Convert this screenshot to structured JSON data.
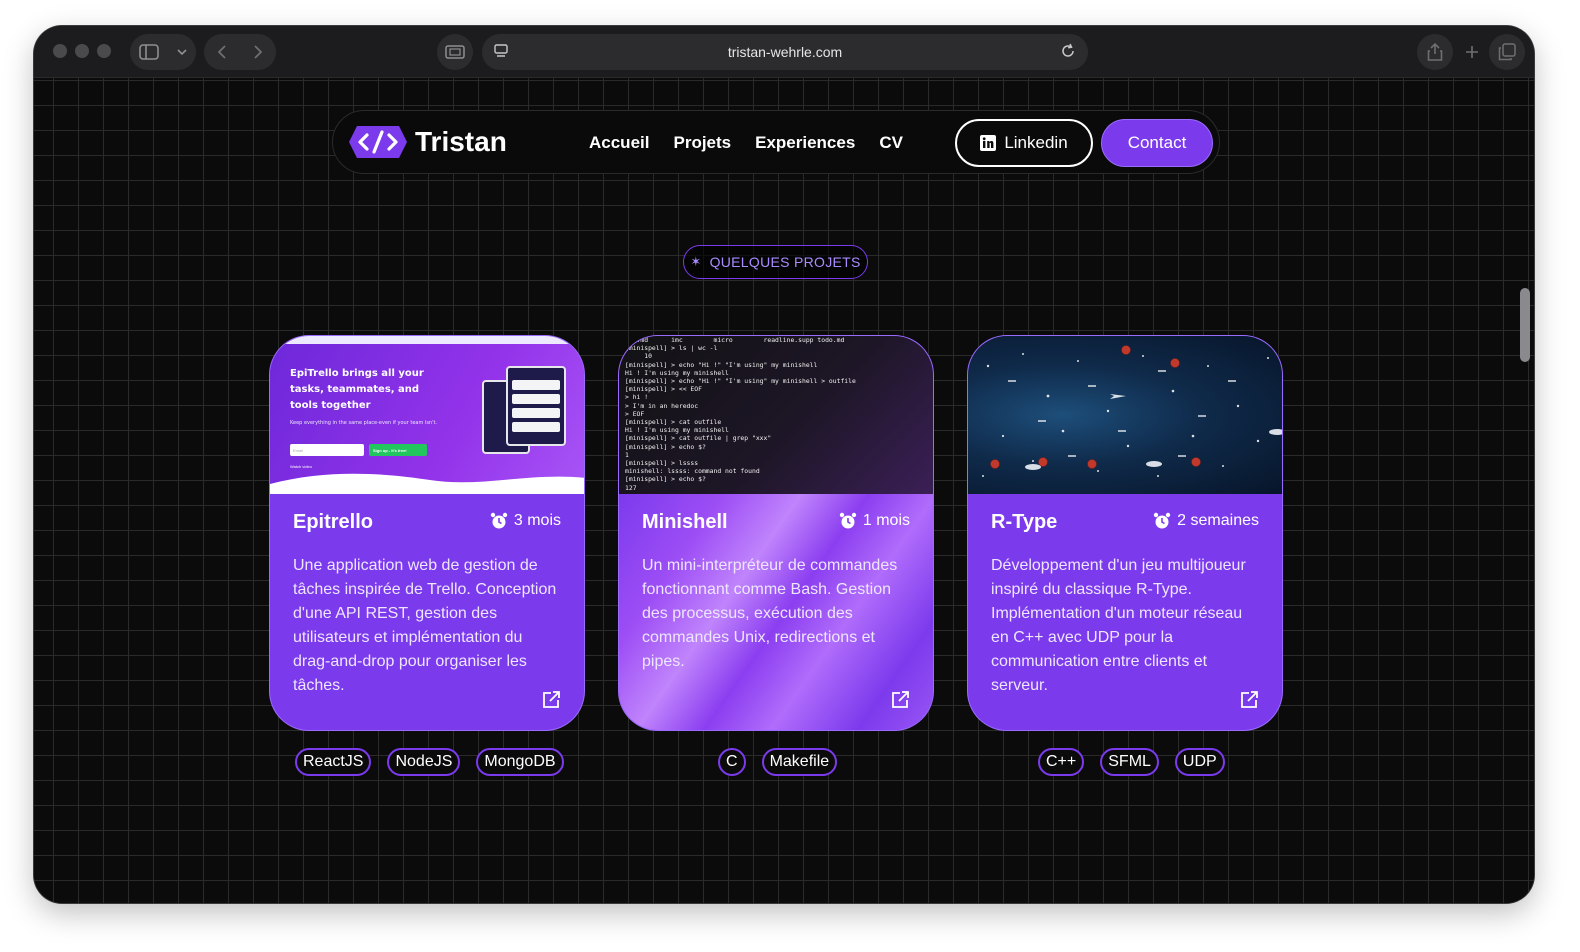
{
  "browser": {
    "url": "tristan-wehrle.com"
  },
  "nav": {
    "logo_text": "Tristan",
    "links": [
      "Accueil",
      "Projets",
      "Experiences",
      "CV"
    ],
    "linkedin_label": "Linkedin",
    "contact_label": "Contact"
  },
  "section": {
    "badge": "QUELQUES PROJETS"
  },
  "projects": [
    {
      "title": "Epitrello",
      "duration": "3 mois",
      "description": "Une application web de gestion de tâches inspirée de Trello. Conception d'une API REST, gestion des utilisateurs et implémentation du drag-and-drop pour organiser les tâches.",
      "tags": [
        "ReactJS",
        "NodeJS",
        "MongoDB"
      ],
      "preview": {
        "headline": "EpiTrello brings all your tasks, teammates, and tools together",
        "subline": "Keep everything in the same place-even if your team isn't.",
        "email_placeholder": "Email",
        "cta": "Sign up - it's free!",
        "watch": "Watch video"
      }
    },
    {
      "title": "Minishell",
      "duration": "1 mois",
      "description": "Un mini-interpréteur de commandes fonctionnant comme Bash. Gestion des processus, exécution des commandes Unix, redirections et pipes.",
      "tags": [
        "C",
        "Makefile"
      ],
      "preview": {
        "terminal": "   .md      imc        micro        readline.supp todo.md\n[minispell] > ls | wc -l\n     10\n[minispell] > echo \"Hi !\" \"I'm using\" my minishell\nHi ! I'm using my minishell\n[minispell] > echo \"Hi !\" \"I'm using\" my minishell > outfile\n[minispell] > << EOF\n> hi !\n> I'm in an heredoc\n> EOF\n[minispell] > cat outfile\nHi ! I'm using my minishell\n[minispell] > cat outfile | grep \"xxx\"\n[minispell] > echo $?\n1\n[minispell] > lssss\nminishell: lssss: command not found\n[minispell] > echo $?\n127"
      }
    },
    {
      "title": "R-Type",
      "duration": "2 semaines",
      "description": "Développement d'un jeu multijoueur inspiré du classique R-Type. Implémentation d'un moteur réseau en C++ avec UDP pour la communication entre clients et serveur.",
      "tags": [
        "C++",
        "SFML",
        "UDP"
      ]
    }
  ],
  "colors": {
    "accent": "#7c3aed",
    "background": "#0b0b0c"
  }
}
